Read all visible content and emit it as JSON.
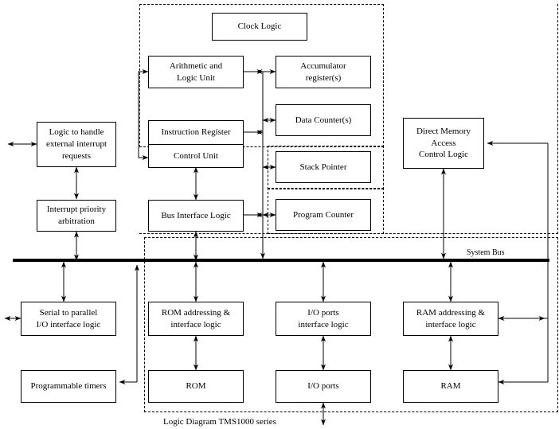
{
  "diagram": {
    "caption": "Logic Diagram TMS1000 series",
    "bus_label": "System Bus",
    "line_color": "#000000",
    "background": "#ffffff"
  },
  "blocks": {
    "clock_logic": {
      "line1": "Clock Logic"
    },
    "alu": {
      "line1": "Arithmetic and",
      "line2": "Logic Unit"
    },
    "accumulator": {
      "line1": "Accumulator",
      "line2": "register(s)"
    },
    "instruction_register": {
      "line1": "Instruction Register"
    },
    "control_unit": {
      "line1": "Control Unit"
    },
    "data_counter": {
      "line1": "Data Counter(s)"
    },
    "stack_pointer": {
      "line1": "Stack Pointer"
    },
    "bus_interface_logic": {
      "line1": "Bus Interface Logic"
    },
    "program_counter": {
      "line1": "Program Counter"
    },
    "external_interrupt": {
      "line1": "Logic to handle",
      "line2": "external interrupt",
      "line3": "requests"
    },
    "interrupt_priority": {
      "line1": "Interrupt priority",
      "line2": "arbitration"
    },
    "dma_control": {
      "line1": "Direct Memory",
      "line2": "Access",
      "line3": "Control Logic"
    },
    "serial_parallel_io": {
      "line1": "Serial to parallel",
      "line2": "I/O interface logic"
    },
    "programmable_timers": {
      "line1": "Programmable timers"
    },
    "rom_addressing": {
      "line1": "ROM addressing &",
      "line2": "interface logic"
    },
    "rom": {
      "line1": "ROM"
    },
    "io_ports_interface": {
      "line1": "I/O ports",
      "line2": "interface logic"
    },
    "io_ports": {
      "line1": "I/O ports"
    },
    "ram_addressing": {
      "line1": "RAM addressing &",
      "line2": "interface logic"
    },
    "ram": {
      "line1": "RAM"
    }
  }
}
